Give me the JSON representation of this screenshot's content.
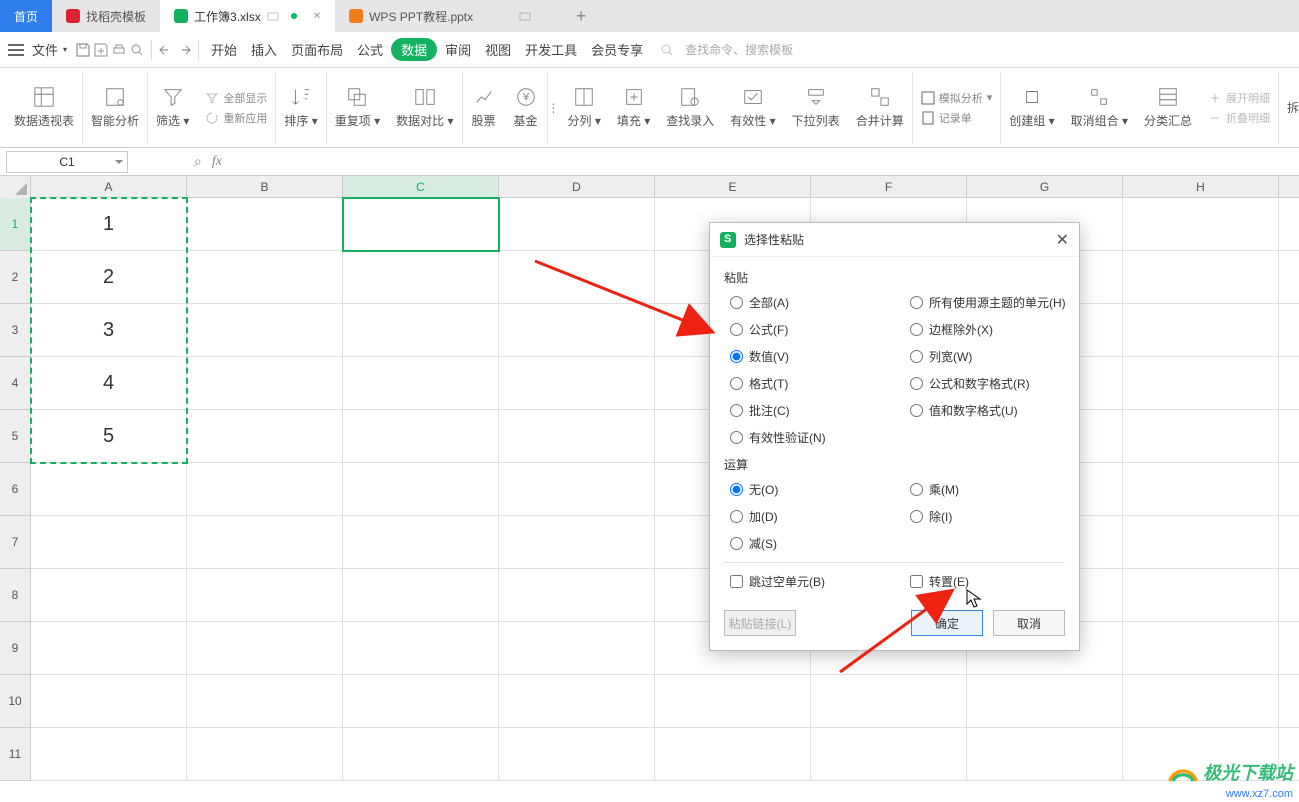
{
  "tabs": {
    "home": "首页",
    "template": "找稻壳模板",
    "workbook": "工作簿3.xlsx",
    "ppt": "WPS PPT教程.pptx"
  },
  "menus": {
    "file": "文件",
    "start": "开始",
    "insert": "插入",
    "layout": "页面布局",
    "formula": "公式",
    "data": "数据",
    "review": "审阅",
    "view": "视图",
    "dev": "开发工具",
    "member": "会员专享",
    "search_ph": "查找命令、搜索模板"
  },
  "ribbon": {
    "pivot": "数据透视表",
    "smart": "智能分析",
    "filter": "筛选",
    "show_all": "全部显示",
    "reapply": "重新应用",
    "sort": "排序",
    "dup": "重复项",
    "compare": "数据对比",
    "stock": "股票",
    "fund": "基金",
    "split": "分列",
    "fill": "填充",
    "lookup": "查找录入",
    "validate": "有效性",
    "dropdown": "下拉列表",
    "consolidate": "合并计算",
    "sim": "模拟分析",
    "record": "记录单",
    "group": "创建组",
    "ungroup": "取消组合",
    "subtotal": "分类汇总",
    "expand": "展开明细",
    "collapse": "折叠明细",
    "splitcol": "拆分"
  },
  "namebox": "C1",
  "columns": [
    "A",
    "B",
    "C",
    "D",
    "E",
    "F",
    "G",
    "H"
  ],
  "rows": [
    "1",
    "2",
    "3",
    "4",
    "5",
    "6",
    "7",
    "8",
    "9",
    "10",
    "11"
  ],
  "cellsA": [
    "1",
    "2",
    "3",
    "4",
    "5"
  ],
  "dialog": {
    "title": "选择性粘贴",
    "section_paste": "粘贴",
    "opt_all": "全部(A)",
    "opt_formula": "公式(F)",
    "opt_value": "数值(V)",
    "opt_format": "格式(T)",
    "opt_comment": "批注(C)",
    "opt_valid": "有效性验证(N)",
    "opt_theme": "所有使用源主题的单元(H)",
    "opt_border": "边框除外(X)",
    "opt_width": "列宽(W)",
    "opt_fmtnum": "公式和数字格式(R)",
    "opt_valnum": "值和数字格式(U)",
    "section_op": "运算",
    "op_none": "无(O)",
    "op_add": "加(D)",
    "op_sub": "减(S)",
    "op_mul": "乘(M)",
    "op_div": "除(I)",
    "chk_skip": "跳过空单元(B)",
    "chk_transpose": "转置(E)",
    "btn_link": "粘贴链接(L)",
    "btn_ok": "确定",
    "btn_cancel": "取消"
  },
  "watermark": {
    "brand": "极光下载站",
    "url": "www.xz7.com"
  }
}
